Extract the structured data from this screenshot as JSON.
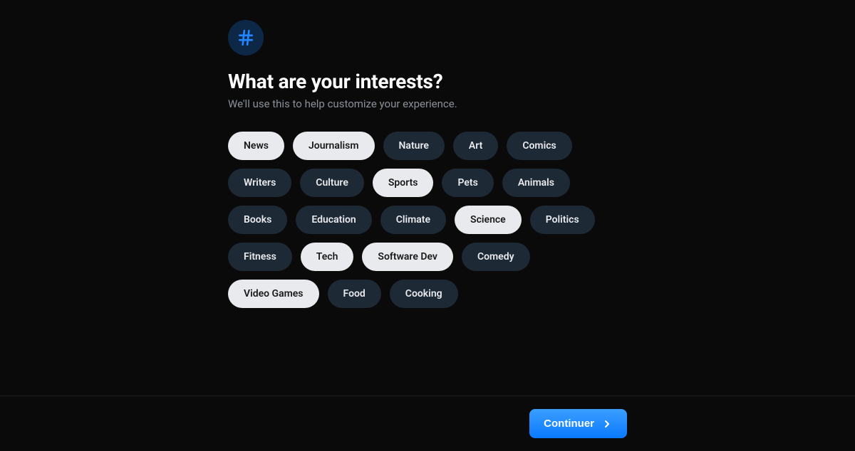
{
  "header": {
    "title": "What are your interests?",
    "subtitle": "We'll use this to help customize your experience."
  },
  "interests": [
    {
      "label": "News",
      "selected": true
    },
    {
      "label": "Journalism",
      "selected": true
    },
    {
      "label": "Nature",
      "selected": false
    },
    {
      "label": "Art",
      "selected": false
    },
    {
      "label": "Comics",
      "selected": false
    },
    {
      "label": "Writers",
      "selected": false
    },
    {
      "label": "Culture",
      "selected": false
    },
    {
      "label": "Sports",
      "selected": true
    },
    {
      "label": "Pets",
      "selected": false
    },
    {
      "label": "Animals",
      "selected": false
    },
    {
      "label": "Books",
      "selected": false
    },
    {
      "label": "Education",
      "selected": false
    },
    {
      "label": "Climate",
      "selected": false
    },
    {
      "label": "Science",
      "selected": true
    },
    {
      "label": "Politics",
      "selected": false
    },
    {
      "label": "Fitness",
      "selected": false
    },
    {
      "label": "Tech",
      "selected": true
    },
    {
      "label": "Software Dev",
      "selected": true
    },
    {
      "label": "Comedy",
      "selected": false
    },
    {
      "label": "Video Games",
      "selected": true
    },
    {
      "label": "Food",
      "selected": false
    },
    {
      "label": "Cooking",
      "selected": false
    }
  ],
  "footer": {
    "continue_label": "Continuer"
  }
}
